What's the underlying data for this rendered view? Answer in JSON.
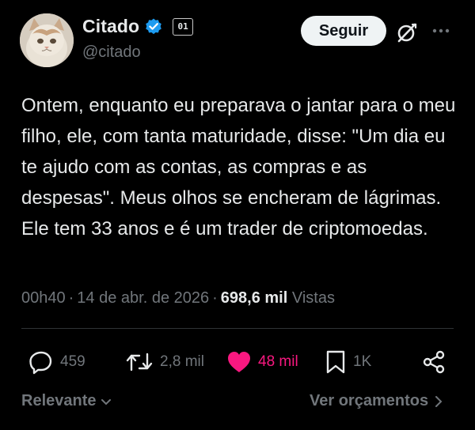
{
  "author": {
    "display_name": "Citado",
    "handle": "@citado",
    "badge_label": "01",
    "avatar_icon": "cat-avatar",
    "verified_icon": "verified-badge-icon"
  },
  "header": {
    "follow_label": "Seguir",
    "grok_icon": "grok-icon",
    "more_icon": "more-icon"
  },
  "post": {
    "text": "Ontem, enquanto eu preparava o jantar para o meu filho, ele, com tanta maturidade, disse: \"Um dia eu te ajudo com as contas, as compras e as despesas\". Meus olhos se encheram de lágrimas. Ele tem 33 anos e é um trader de criptomoedas.",
    "time": "00h40",
    "date": "14 de abr. de 2026",
    "views_count": "698,6 mil",
    "views_label": "Vistas"
  },
  "actions": {
    "replies": "459",
    "reposts": "2,8 mil",
    "likes": "48 mil",
    "bookmarks": "1K"
  },
  "footer": {
    "sort_label": "Relevante",
    "budget_label": "Ver orçamentos"
  },
  "colors": {
    "background": "#000000",
    "primary_text": "#e7e9ea",
    "secondary_text": "#71767b",
    "like": "#f91880",
    "verified": "#1d9bf0"
  }
}
